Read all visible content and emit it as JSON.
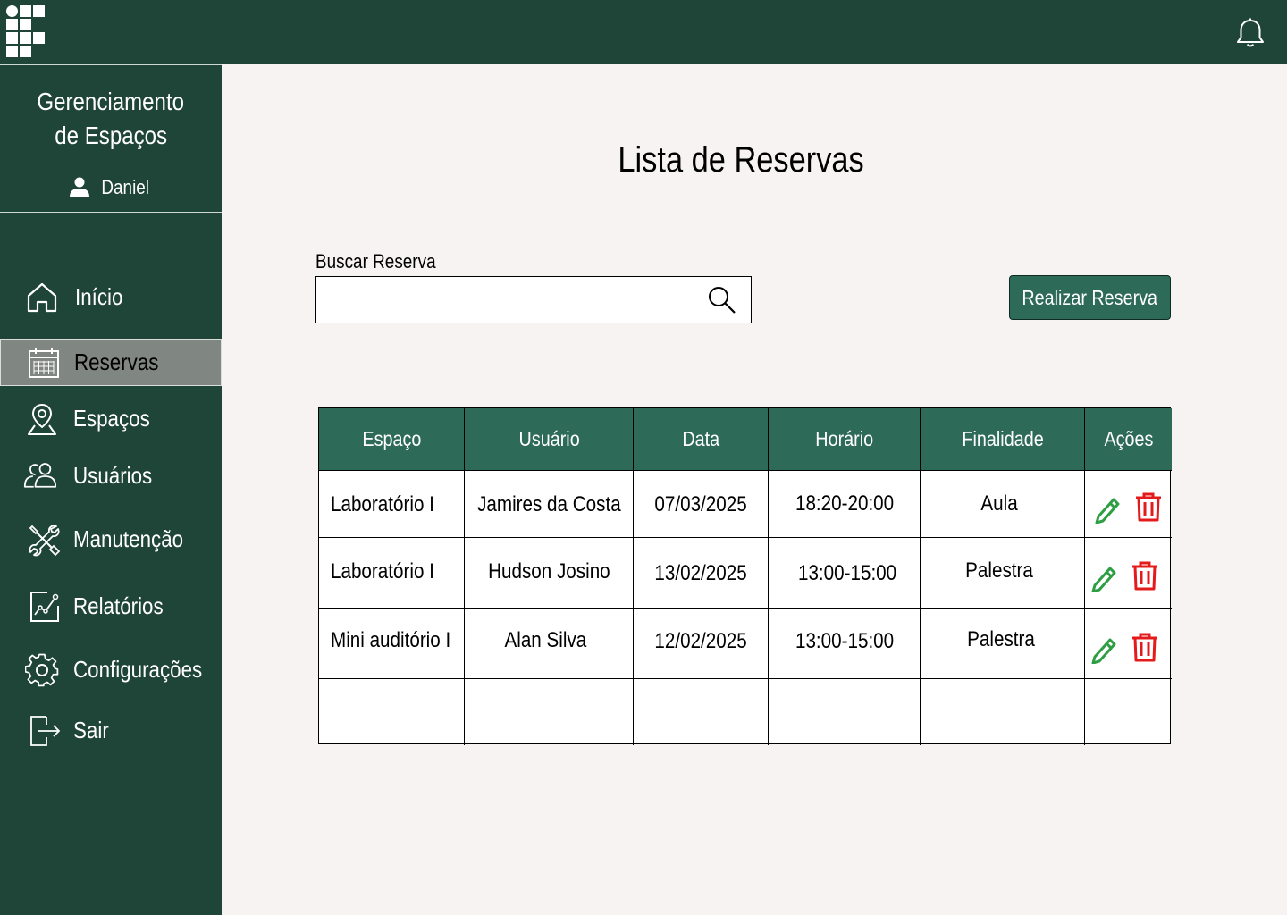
{
  "sidebar": {
    "app_title_line1": "Gerenciamento",
    "app_title_line2": "de Espaços",
    "user_name": "Daniel",
    "items": [
      {
        "label": "Início",
        "icon": "home-icon"
      },
      {
        "label": "Reservas",
        "icon": "calendar-icon",
        "active": true
      },
      {
        "label": "Espaços",
        "icon": "map-pin-icon"
      },
      {
        "label": "Usuários",
        "icon": "users-icon"
      },
      {
        "label": "Manutenção",
        "icon": "tools-icon"
      },
      {
        "label": "Relatórios",
        "icon": "report-chart-icon"
      },
      {
        "label": "Configurações",
        "icon": "gear-icon"
      },
      {
        "label": "Sair",
        "icon": "logout-icon"
      }
    ]
  },
  "main": {
    "title": "Lista de Reservas",
    "search": {
      "label": "Buscar Reserva",
      "placeholder": "",
      "value": ""
    },
    "reserve_button": "Realizar Reserva"
  },
  "table": {
    "columns": [
      "Espaço",
      "Usuário",
      "Data",
      "Horário",
      "Finalidade",
      "Ações"
    ],
    "rows": [
      {
        "espaco": "Laboratório I",
        "usuario": "Jamires da Costa",
        "data": "07/03/2025",
        "horario": "18:20-20:00",
        "finalidade": "Aula"
      },
      {
        "espaco": "Laboratório I",
        "usuario": "Hudson Josino",
        "data": "13/02/2025",
        "horario": "13:00-15:00",
        "finalidade": "Palestra"
      },
      {
        "espaco": "Mini auditório I",
        "usuario": "Alan Silva",
        "data": "12/02/2025",
        "horario": "13:00-15:00",
        "finalidade": "Palestra"
      }
    ]
  },
  "colors": {
    "dark_green": "#1f4438",
    "table_header_green": "#2e6a58",
    "edit_icon_green": "#2e9e44",
    "delete_icon_red": "#e41b1b",
    "active_nav_gray": "#808682",
    "page_background": "#f6f3f2"
  }
}
